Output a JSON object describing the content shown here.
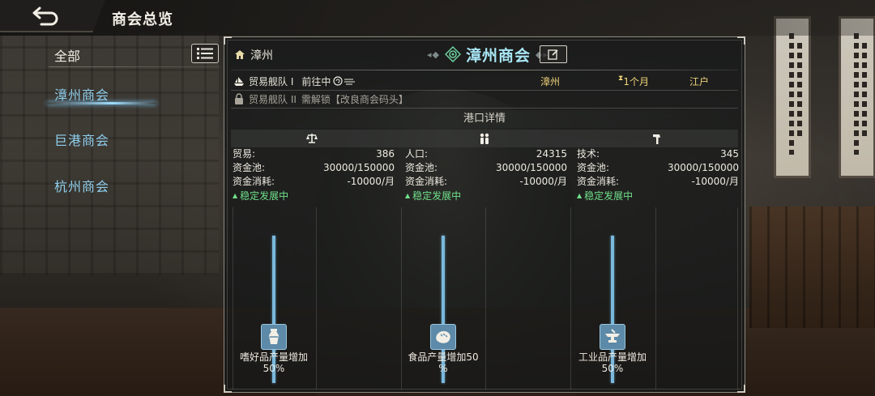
{
  "header": {
    "title": "商会总览",
    "back_icon": "back-arrow-icon"
  },
  "sidebar": {
    "all_label": "全部",
    "items": [
      {
        "label": "漳州商会",
        "active": true
      },
      {
        "label": "巨港商会",
        "active": false
      },
      {
        "label": "杭州商会",
        "active": false
      }
    ]
  },
  "panel": {
    "port_name": "漳州",
    "chamber_name": "漳州商会",
    "fleets": [
      {
        "name": "贸易舰队 I",
        "status": "前往中",
        "from": "漳州",
        "duration": "1个月",
        "to": "江户"
      },
      {
        "name": "贸易舰队 II",
        "lock_text": "需解锁【改良商会码头】"
      }
    ],
    "section_title": "港口详情",
    "columns": [
      {
        "icon": "scales-icon",
        "stats": [
          {
            "label": "贸易:",
            "value": "386"
          },
          {
            "label": "资金池:",
            "value": "30000/150000"
          },
          {
            "label": "资金消耗:",
            "value": "-10000/月"
          }
        ],
        "trend": "稳定发展中",
        "product_icon": "vase-icon",
        "product_line1": "嗜好品产量增加",
        "product_line2": "50%",
        "bar_level": "50%"
      },
      {
        "icon": "people-icon",
        "stats": [
          {
            "label": "人口:",
            "value": "24315"
          },
          {
            "label": "资金池:",
            "value": "30000/150000"
          },
          {
            "label": "资金消耗:",
            "value": "-10000/月"
          }
        ],
        "trend": "稳定发展中",
        "product_icon": "bread-icon",
        "product_line1": "食品产量增加50",
        "product_line2": "%",
        "bar_level": "50%"
      },
      {
        "icon": "hammer-icon",
        "stats": [
          {
            "label": "技术:",
            "value": "345"
          },
          {
            "label": "资金池:",
            "value": "30000/150000"
          },
          {
            "label": "资金消耗:",
            "value": "-10000/月"
          }
        ],
        "trend": "稳定发展中",
        "product_icon": "anvil-icon",
        "product_line1": "工业品产量增加",
        "product_line2": "50%",
        "bar_level": "50%"
      }
    ]
  }
}
